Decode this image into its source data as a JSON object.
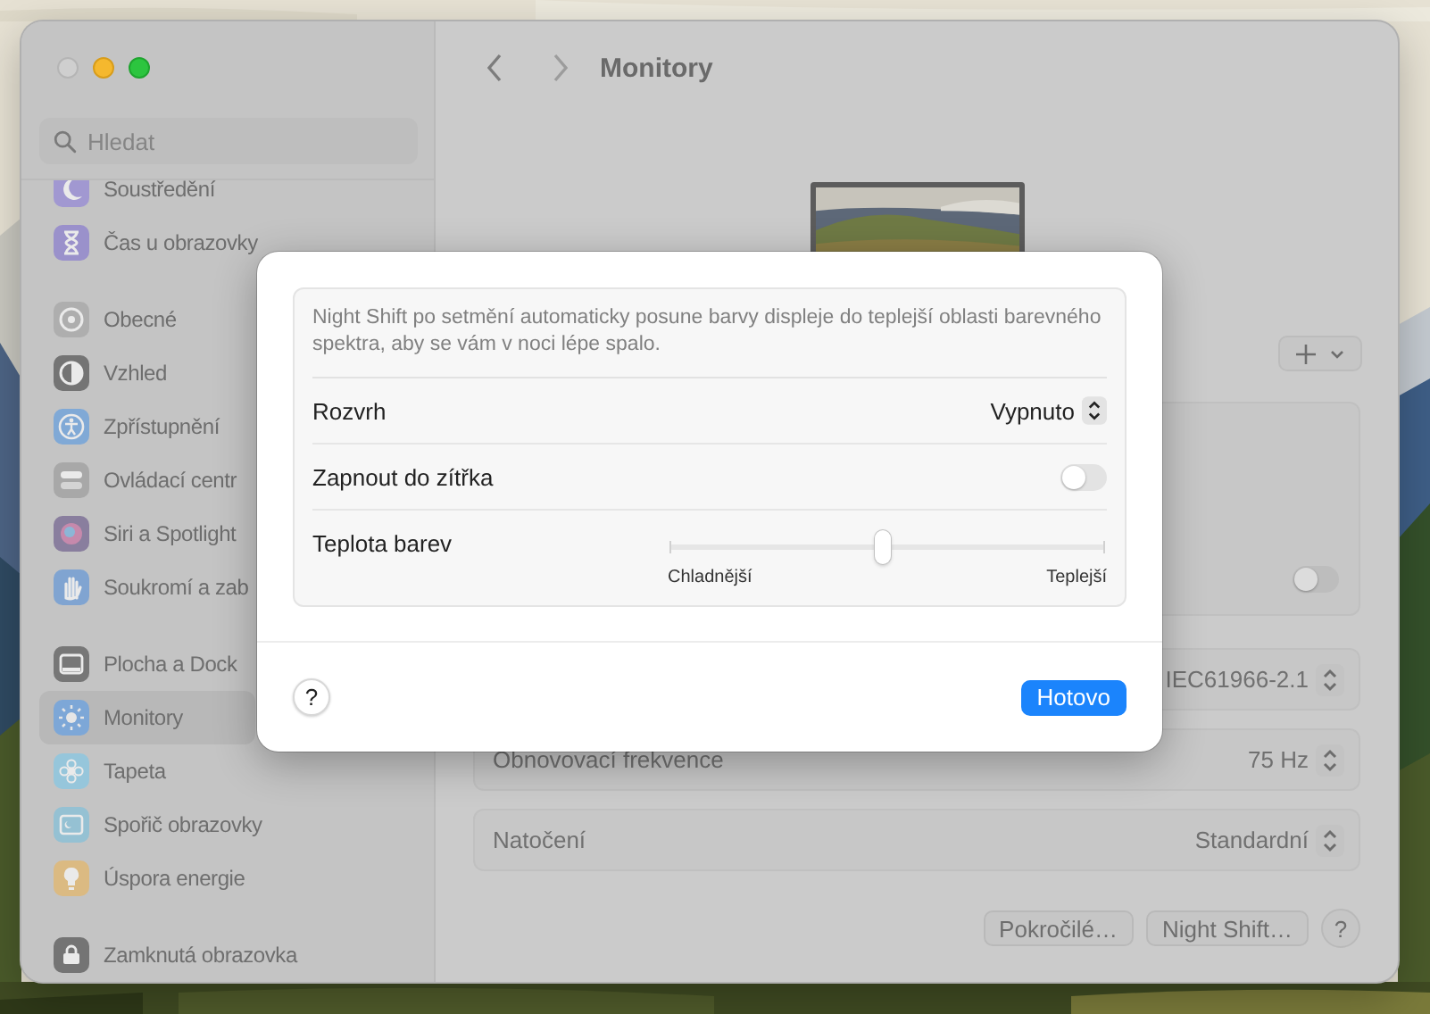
{
  "sidebar": {
    "search": {
      "placeholder": "Hledat"
    },
    "sections": [
      {
        "items": [
          {
            "label": "Soustředění",
            "kind": "moon",
            "selected": false
          },
          {
            "label": "Čas u obrazovky",
            "kind": "hourglass",
            "selected": false
          }
        ]
      },
      {
        "items": [
          {
            "label": "Obecné",
            "kind": "gear",
            "selected": false
          },
          {
            "label": "Vzhled",
            "kind": "appearance",
            "selected": false
          },
          {
            "label": "Zpřístupnění",
            "kind": "accessibility",
            "selected": false
          },
          {
            "label": "Ovládací centr",
            "kind": "switches",
            "selected": false
          },
          {
            "label": "Siri a Spotlight",
            "kind": "siri",
            "selected": false
          },
          {
            "label": "Soukromí a zab",
            "kind": "hand",
            "selected": false
          }
        ]
      },
      {
        "items": [
          {
            "label": "Plocha a Dock",
            "kind": "dock",
            "selected": false
          },
          {
            "label": "Monitory",
            "kind": "sun",
            "selected": true
          },
          {
            "label": "Tapeta",
            "kind": "flower",
            "selected": false
          },
          {
            "label": "Spořič obrazovky",
            "kind": "screensaver",
            "selected": false
          },
          {
            "label": "Úspora energie",
            "kind": "bulb",
            "selected": false
          }
        ]
      },
      {
        "items": [
          {
            "label": "Zamknutá obrazovka",
            "kind": "lock",
            "selected": false
          }
        ]
      }
    ]
  },
  "main": {
    "title": "Monitory",
    "group_toggle": {
      "on": false
    },
    "rows": [
      {
        "value": "IEC61966-2.1"
      },
      {
        "label": "Obnovovací frekvence",
        "value": "75 Hz"
      },
      {
        "label": "Natočení",
        "value": "Standardní"
      }
    ],
    "buttons": [
      "Pokročilé…",
      "Night Shift…"
    ],
    "help": "?"
  },
  "dialog": {
    "description": "Night Shift po setmění automaticky posune barvy displeje do teplejší oblasti barevného spektra, aby se vám v noci lépe spalo.",
    "schedule": {
      "label": "Rozvrh",
      "value": "Vypnuto"
    },
    "until_tomorrow": {
      "label": "Zapnout do zítřka",
      "on": false
    },
    "color_temperature": {
      "label": "Teplota barev",
      "level": 0.49,
      "min_label": "Chladnější",
      "max_label": "Teplejší"
    },
    "help": "?",
    "done": "Hotovo"
  }
}
